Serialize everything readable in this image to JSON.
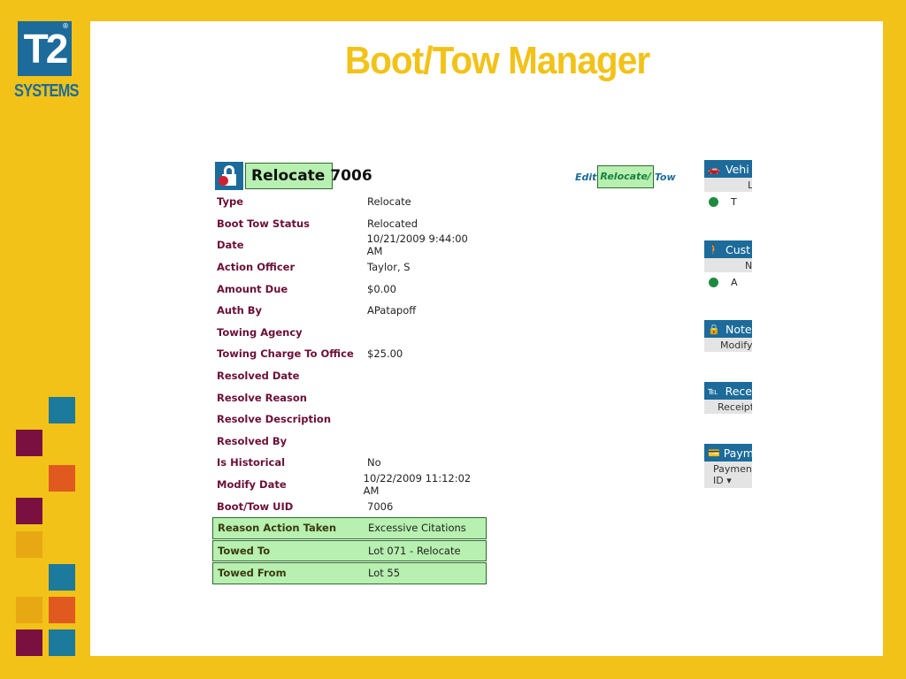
{
  "logo": {
    "main": "T2",
    "reg": "®",
    "sub": "SYSTEMS"
  },
  "slide": {
    "title": "Boot/Tow Manager"
  },
  "record": {
    "title_highlight": "Relocate",
    "title_rest": "7006",
    "edit_prefix": "Edit",
    "edit_highlight": "Relocate/",
    "edit_suffix": "Tow",
    "fields": [
      {
        "label": "Type",
        "value": "Relocate"
      },
      {
        "label": "Boot Tow Status",
        "value": "Relocated"
      },
      {
        "label": "Date",
        "value": "10/21/2009 9:44:00 AM"
      },
      {
        "label": "Action Officer",
        "value": "Taylor, S"
      },
      {
        "label": "Amount Due",
        "value": "$0.00"
      },
      {
        "label": "Auth By",
        "value": "APatapoff"
      },
      {
        "label": "Towing Agency",
        "value": ""
      },
      {
        "label": "Towing Charge To Office",
        "value": "$25.00"
      },
      {
        "label": "Resolved Date",
        "value": ""
      },
      {
        "label": "Resolve Reason",
        "value": ""
      },
      {
        "label": "Resolve Description",
        "value": ""
      },
      {
        "label": "Resolved By",
        "value": ""
      },
      {
        "label": "Is Historical",
        "value": "No"
      },
      {
        "label": "Modify Date",
        "value": "10/22/2009 11:12:02 AM"
      },
      {
        "label": "Boot/Tow UID",
        "value": "7006"
      },
      {
        "label": "Reason Action Taken",
        "value": "Excessive Citations"
      },
      {
        "label": "Towed To",
        "value": "Lot 071 - Relocate"
      },
      {
        "label": "Towed From",
        "value": "Lot 55"
      }
    ]
  },
  "panels": {
    "vehicles": {
      "title": "Vehi",
      "sub": "L",
      "row": "T"
    },
    "customers": {
      "title": "Cust",
      "sub": "N",
      "row": "A"
    },
    "notes": {
      "title": "Note",
      "sub": "Modify"
    },
    "receipts": {
      "title": "Rece",
      "sub": "Receipt"
    },
    "payments": {
      "title": "Paym",
      "sub1": "Paymen",
      "sub2": "ID ▾"
    }
  },
  "colors": {
    "background": "#f2c218",
    "brand_blue": "#1c6b9a",
    "highlight": "#b7f0b0",
    "label": "#6a1038"
  }
}
